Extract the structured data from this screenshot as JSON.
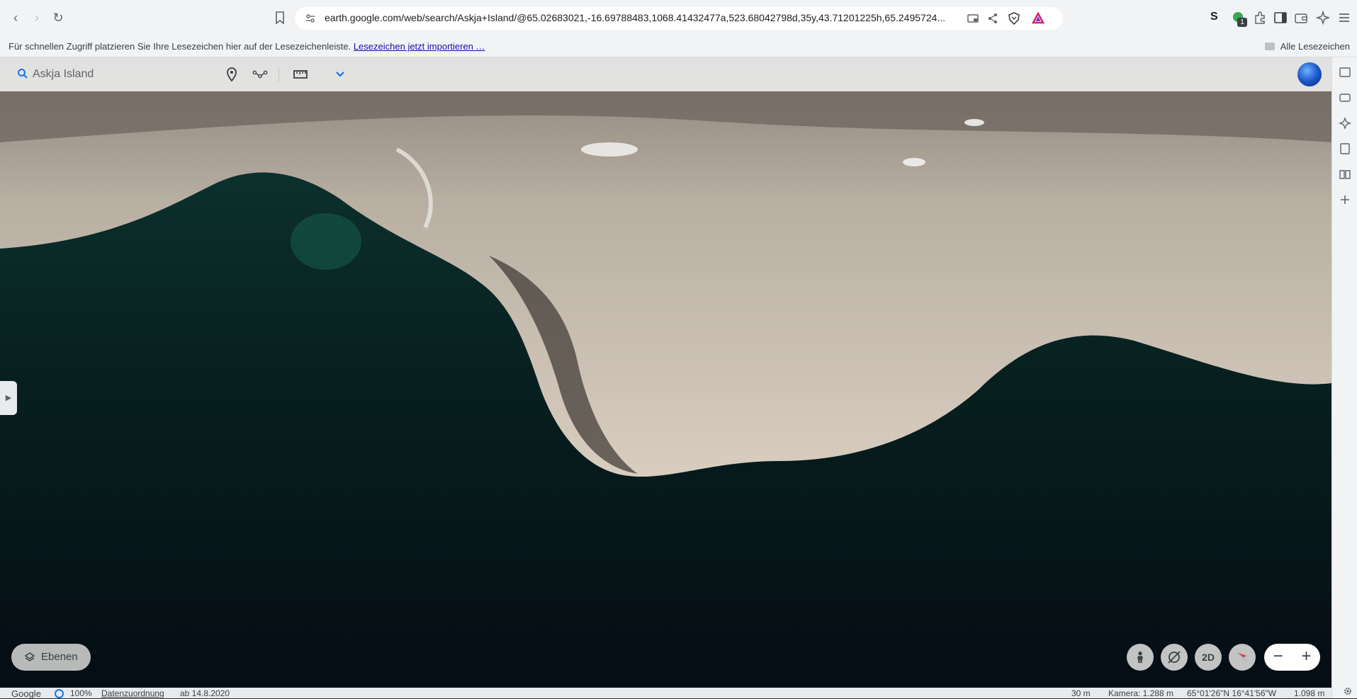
{
  "browser": {
    "url": "earth.google.com/web/search/Askja+Island/@65.02683021,-16.69788483,1068.41432477a,523.68042798d,35y,43.71201225h,65.2495724...",
    "bookmarks_hint": "Für schnellen Zugriff platzieren Sie Ihre Lesezeichen hier auf der Lesezeichenleiste.",
    "bookmarks_import_link": "Lesezeichen jetzt importieren …",
    "all_bookmarks": "Alle Lesezeichen",
    "extension_badge": "1"
  },
  "earth": {
    "search_value": "Askja Island",
    "layers_label": "Ebenen",
    "view_toggle_label": "2D",
    "zoom_out": "−",
    "zoom_in": "+"
  },
  "status": {
    "brand": "Google",
    "percent": "100%",
    "attribution": "Datenzuordnung",
    "imagery_date": "ab 14.8.2020",
    "scale": "30 m",
    "camera": "Kamera: 1.288 m",
    "coordinates": "65°01'26\"N 16°41'56\"W",
    "elevation": "1.098 m"
  },
  "icons": [
    "back-icon",
    "forward-icon",
    "reload-icon",
    "bookmark-icon",
    "site-settings-icon",
    "cast-icon",
    "share-icon",
    "brave-shield-icon",
    "brave-rewards-icon",
    "search-icon",
    "place-marker-icon",
    "path-icon",
    "ruler-icon",
    "chevron-down-icon",
    "globe-icon",
    "layers-icon",
    "pegman-icon",
    "compass-icon",
    "settings-icon"
  ]
}
